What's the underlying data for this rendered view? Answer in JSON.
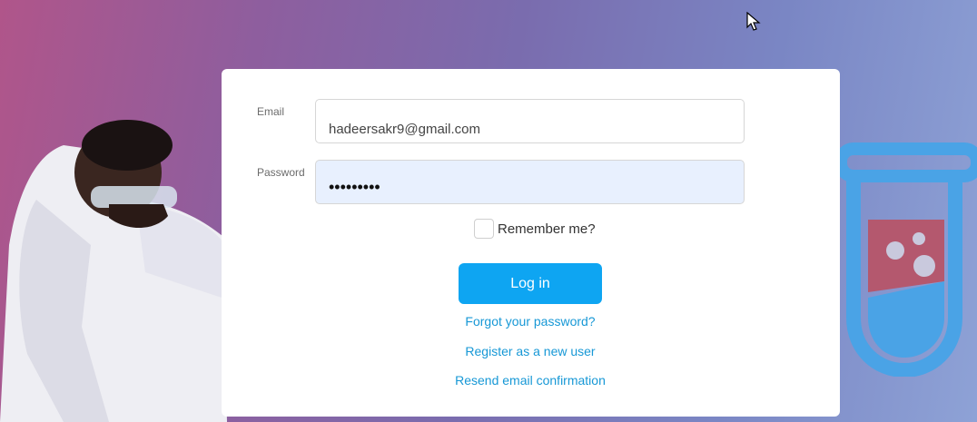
{
  "form": {
    "email_label": "Email",
    "email_value": "hadeersakr9@gmail.com",
    "password_label": "Password",
    "password_value": "•••••••••",
    "remember_label": "Remember me?",
    "remember_checked": false,
    "login_label": "Log in"
  },
  "links": {
    "forgot": "Forgot your password?",
    "register": "Register as a new user",
    "resend": "Resend email confirmation"
  },
  "colors": {
    "accent": "#0ea5f2",
    "link": "#1798d6",
    "password_fill": "#e8f0fe"
  },
  "icons": {
    "background_left": "scientist-image",
    "background_right": "test-tube-icon",
    "cursor": "mouse-cursor-icon"
  }
}
